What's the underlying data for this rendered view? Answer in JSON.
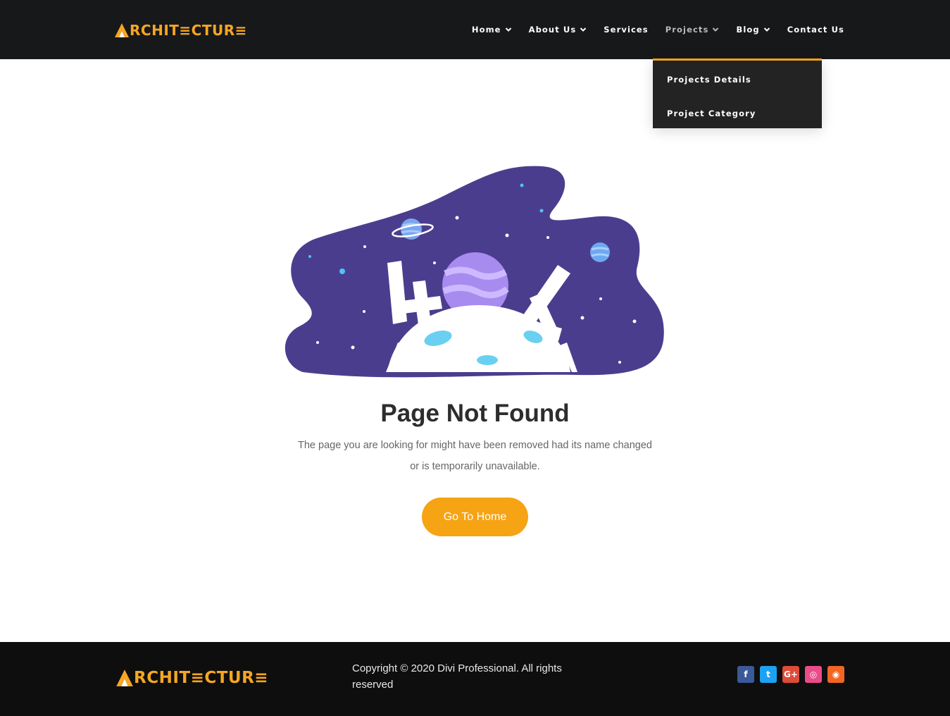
{
  "header": {
    "logo_text": "RCHIT≡CTUR≡",
    "nav": [
      {
        "label": "Home",
        "has_dropdown": true
      },
      {
        "label": "About Us",
        "has_dropdown": true
      },
      {
        "label": "Services",
        "has_dropdown": false
      },
      {
        "label": "Projects",
        "has_dropdown": true,
        "active": true
      },
      {
        "label": "Blog",
        "has_dropdown": true
      },
      {
        "label": "Contact Us",
        "has_dropdown": false
      }
    ],
    "dropdown": [
      "Projects Details",
      "Project Category"
    ]
  },
  "main": {
    "illustration": "404",
    "title": "Page Not Found",
    "description_line1": "The page you are looking for might have been removed had its name changed",
    "description_line2": "or is temporarily unavailable.",
    "button_label": "Go To Home"
  },
  "footer": {
    "logo_text": "RCHIT≡CTUR≡",
    "copyright": "Copyright © 2020 Divi Professional. All rights reserved",
    "socials": [
      {
        "name": "facebook-icon",
        "glyph": "f",
        "color": "#3b5998"
      },
      {
        "name": "twitter-icon",
        "glyph": "t",
        "color": "#1da1f2"
      },
      {
        "name": "google-plus-icon",
        "glyph": "G+",
        "color": "#dd4b39"
      },
      {
        "name": "dribbble-icon",
        "glyph": "◎",
        "color": "#ea4c89"
      },
      {
        "name": "rss-icon",
        "glyph": "◉",
        "color": "#f26522"
      }
    ]
  },
  "colors": {
    "accent": "#f6a314",
    "header_bg": "#17181a",
    "footer_bg": "#0e0e0e",
    "illustration_bg": "#4b3d8e"
  }
}
